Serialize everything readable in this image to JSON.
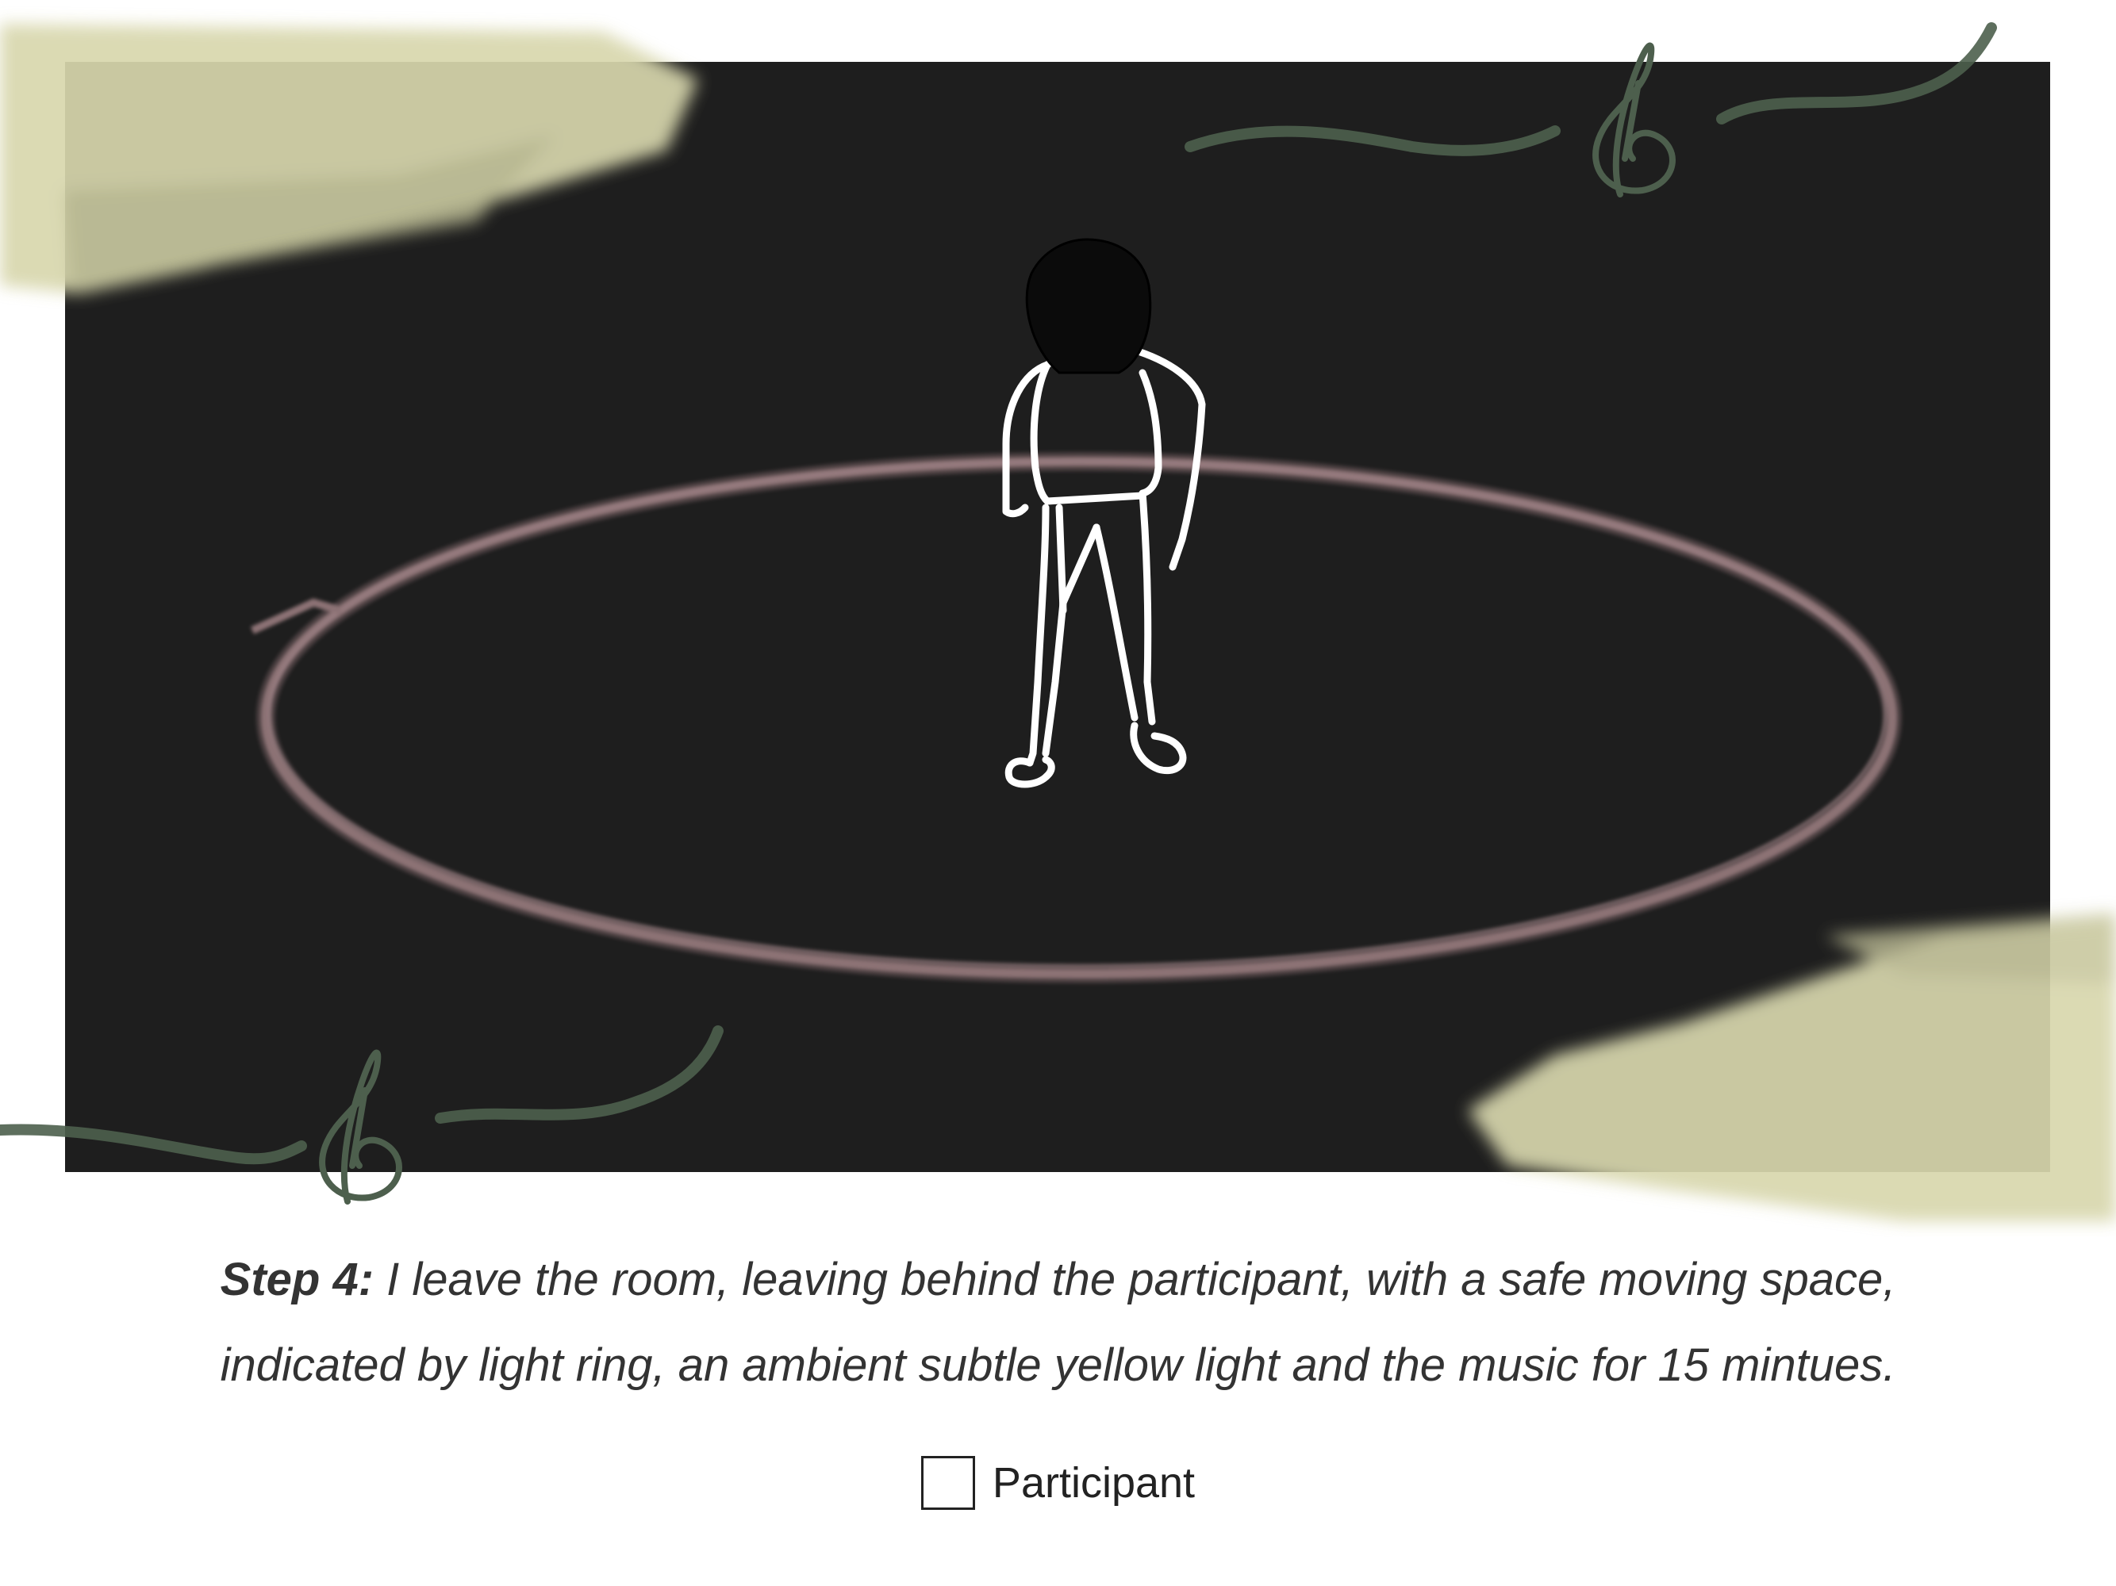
{
  "caption": {
    "step_label": "Step 4:",
    "line1": "I leave the room, leaving behind the participant, with a safe moving space,",
    "line2": "indicated by light ring, an ambient subtle yellow light and the music for 15 mintues."
  },
  "legend": {
    "items": [
      {
        "label": "Participant"
      }
    ]
  },
  "colors": {
    "room_floor": "#1e1e1e",
    "light_ring": "#8c7275",
    "ambient_light": "#d8d7ad",
    "music": "#4d5f4d",
    "figure_outline": "#ffffff",
    "figure_head": "#0b0b0b"
  },
  "icons": [
    "treble-clef-icon",
    "treble-clef-icon"
  ]
}
